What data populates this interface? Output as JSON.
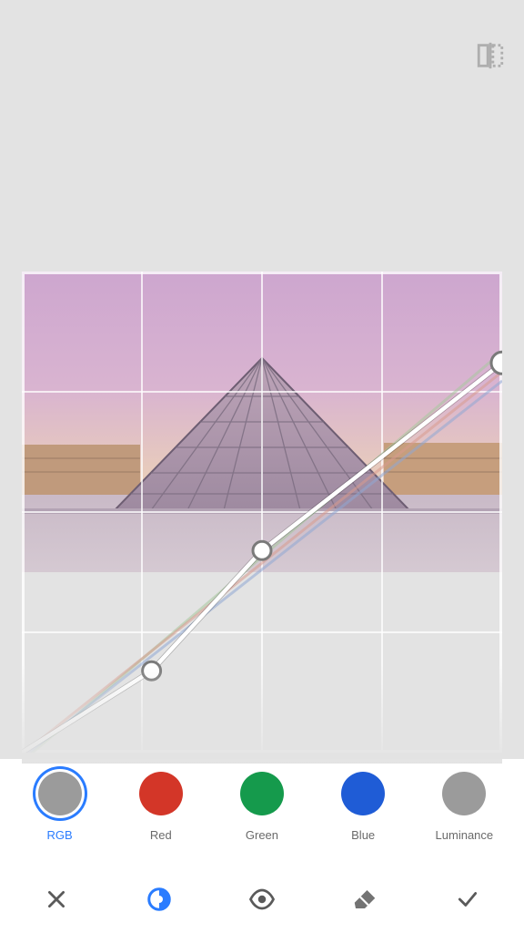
{
  "header": {
    "mirror_icon": "flip-horizontal"
  },
  "channels": [
    {
      "id": "rgb",
      "label": "RGB",
      "color": "#9b9b9b",
      "selected": true
    },
    {
      "id": "red",
      "label": "Red",
      "color": "#d33628",
      "selected": false
    },
    {
      "id": "green",
      "label": "Green",
      "color": "#159a4c",
      "selected": false
    },
    {
      "id": "blue",
      "label": "Blue",
      "color": "#1f5cd6",
      "selected": false
    },
    {
      "id": "luminance",
      "label": "Luminance",
      "color": "#9b9b9b",
      "selected": false
    }
  ],
  "toolbar": {
    "cancel_icon": "x",
    "tool1_icon": "contrast-target",
    "tool2_icon": "eye",
    "tool3_icon": "eraser",
    "confirm_icon": "check",
    "active_tool": "tool1"
  },
  "curve": {
    "grid_divisions": 4,
    "points_normalized": [
      {
        "x": 0.0,
        "y": 0.0
      },
      {
        "x": 0.27,
        "y": 0.17
      },
      {
        "x": 0.5,
        "y": 0.42
      },
      {
        "x": 1.0,
        "y": 0.81
      }
    ],
    "background_lines": [
      {
        "color": "#a8c99f"
      },
      {
        "color": "#d99a8e"
      },
      {
        "color": "#8fa8d4"
      }
    ]
  }
}
